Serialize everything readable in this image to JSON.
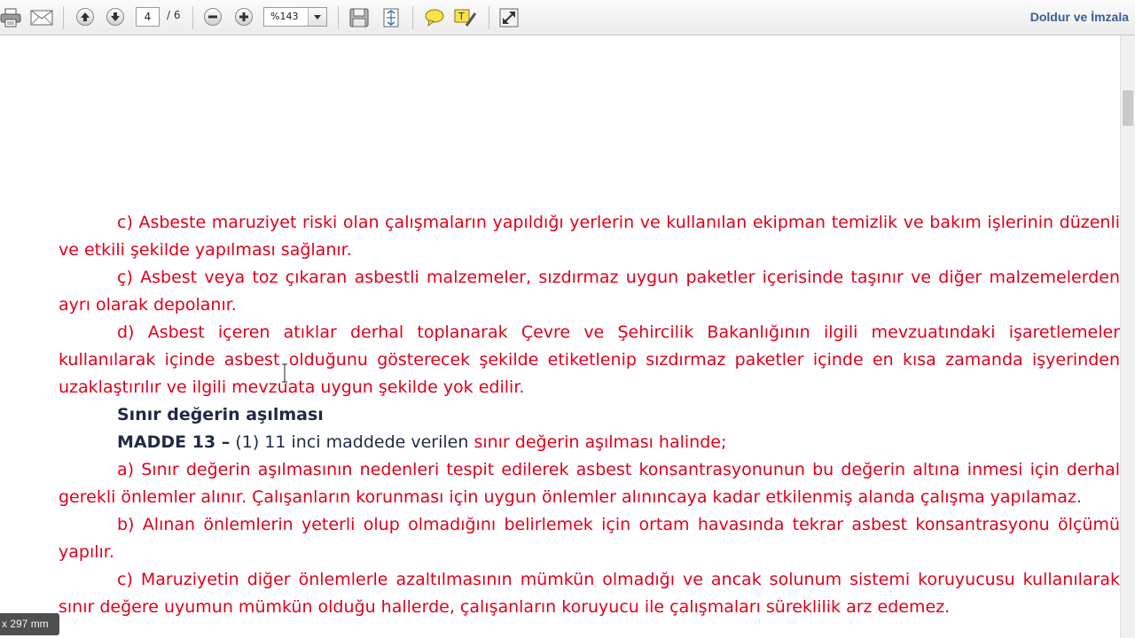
{
  "toolbar": {
    "page_current": "4",
    "page_total": "/ 6",
    "zoom": "%143",
    "sign_label": "Doldur ve İmzala",
    "icons": [
      "print-icon",
      "email-icon",
      "previous-page-icon",
      "next-page-icon",
      "zoom-out-icon",
      "zoom-in-icon",
      "chevron-down-icon",
      "save-icon",
      "fit-page-icon",
      "comment-icon",
      "highlight-icon",
      "expand-icon"
    ]
  },
  "document": {
    "p1": "c) Asbeste maruziyet riski olan çalışmaların yapıldığı yerlerin ve kullanılan ekipman temizlik ve bakım işlerinin düzenli ve etkili şekilde yapılması sağlanır.",
    "p2": "ç) Asbest veya toz çıkaran asbestli malzemeler, sızdırmaz uygun paketler içerisinde taşınır ve diğer malzemelerden ayrı olarak depolanır.",
    "p3": "d) Asbest içeren atıklar derhal toplanarak Çevre ve Şehircilik Bakanlığının ilgili mevzuatındaki işaretlemeler kullanılarak içinde asbest olduğunu gösterecek şekilde etiketlenip sızdırmaz paketler içinde en kısa zamanda işyerinden uzaklaştırılır ve ilgili mevzuata uygun şekilde yok edilir.",
    "heading": "Sınır değerin aşılması",
    "madde_label": "MADDE 13 –",
    "madde_text": " (1) 11 inci maddede verilen ",
    "madde_red": "sınır değerin aşılması halinde;",
    "p4": "a) Sınır değerin aşılmasının nedenleri tespit edilerek asbest konsantrasyonunun bu değerin altına inmesi için derhal gerekli önlemler alınır. Çalışanların korunması için uygun önlemler alınıncaya kadar etkilenmiş alanda çalışma yapılamaz.",
    "p5": "b) Alınan önlemlerin yeterli olup olmadığını belirlemek için ortam havasında tekrar asbest konsantrasyonu ölçümü yapılır.",
    "p6": "c) Maruziyetin diğer önlemlerle azaltılmasının mümkün olmadığı ve ancak solunum sistemi koruyucusu kullanılarak sınır değere uyumun mümkün olduğu hallerde, çalışanların koruyucu ile çalışmaları süreklilik arz edemez."
  },
  "status": {
    "page_size": "x 297 mm"
  },
  "colors": {
    "red_text": "#e0001b",
    "dark_text": "#1f2a44",
    "sign_link": "#3a5f93"
  }
}
